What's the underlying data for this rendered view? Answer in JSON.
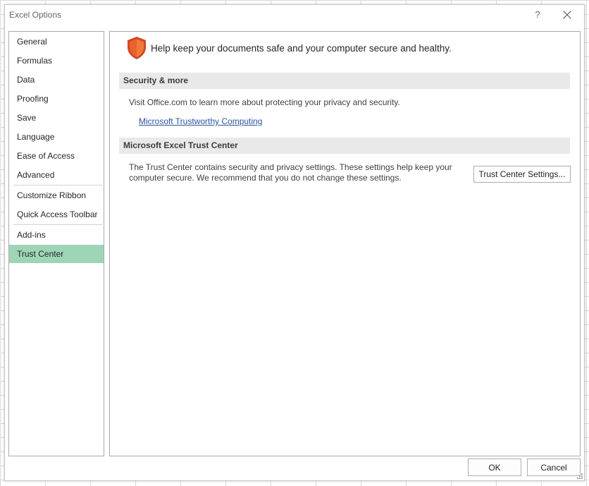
{
  "window": {
    "title": "Excel Options",
    "help_label": "?",
    "close_icon": "close-icon"
  },
  "sidebar": {
    "items": [
      {
        "label": "General"
      },
      {
        "label": "Formulas"
      },
      {
        "label": "Data"
      },
      {
        "label": "Proofing"
      },
      {
        "label": "Save"
      },
      {
        "label": "Language"
      },
      {
        "label": "Ease of Access"
      },
      {
        "label": "Advanced"
      },
      {
        "label": "Customize Ribbon"
      },
      {
        "label": "Quick Access Toolbar"
      },
      {
        "label": "Add-ins"
      },
      {
        "label": "Trust Center",
        "selected": true
      }
    ],
    "selected_color": "#9fd5b7"
  },
  "main": {
    "header_icon": "shield-icon",
    "headline": "Help keep your documents safe and your computer secure and healthy.",
    "security_section": {
      "title": "Security & more",
      "description": "Visit Office.com to learn more about protecting your privacy and security.",
      "link_label": "Microsoft Trustworthy Computing"
    },
    "trust_section": {
      "title": "Microsoft Excel Trust Center",
      "description": "The Trust Center contains security and privacy settings. These settings help keep your computer secure. We recommend that you do not change these settings.",
      "button_label": "Trust Center Settings..."
    },
    "shield_colors": {
      "outer": "#d24726",
      "inner": "#f07a3a"
    },
    "link_color": "#2b579a"
  },
  "footer": {
    "ok_label": "OK",
    "cancel_label": "Cancel"
  }
}
